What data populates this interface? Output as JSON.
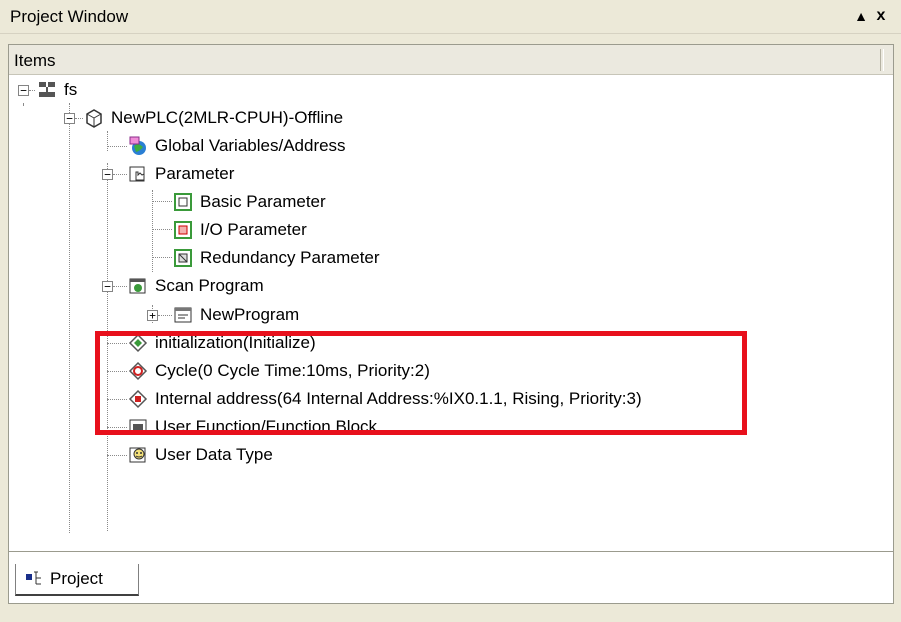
{
  "window": {
    "title": "Project Window",
    "pin_glyph": "▲",
    "close_glyph": "x"
  },
  "header": {
    "column_label": "Items"
  },
  "tree": {
    "root": "fs",
    "plc": "NewPLC(2MLR-CPUH)-Offline",
    "global_vars": "Global Variables/Address",
    "parameter": "Parameter",
    "basic_param": "Basic Parameter",
    "io_param": "I/O Parameter",
    "redundancy_param": "Redundancy Parameter",
    "scan_program": "Scan Program",
    "new_program": "NewProgram",
    "task_init": "initialization(Initialize)",
    "task_cycle": "Cycle(0 Cycle Time:10ms, Priority:2)",
    "task_internal": "Internal address(64 Internal Address:%IX0.1.1, Rising, Priority:3)",
    "user_function": "User Function/Function Block",
    "user_data_type": "User Data Type"
  },
  "expanders": {
    "expanded": "−",
    "collapsed": "+"
  },
  "tabs": {
    "project": "Project"
  },
  "colors": {
    "highlight": "#e8101c",
    "panel_bg": "#ffffff",
    "chrome": "#ece9d8"
  }
}
